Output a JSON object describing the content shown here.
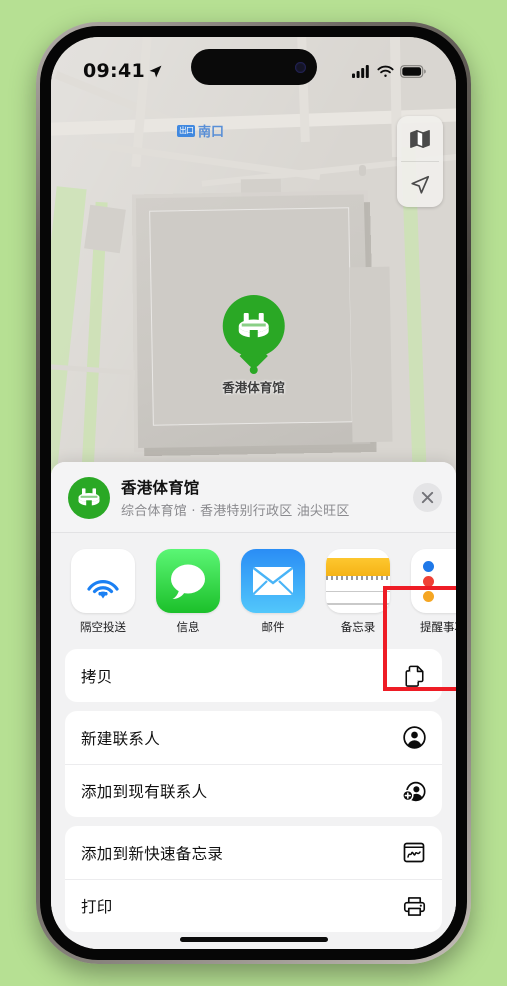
{
  "status_bar": {
    "time": "09:41",
    "location_icon": "location-arrow-icon",
    "signal_icon": "cellular-signal-icon",
    "wifi_icon": "wifi-icon",
    "battery_icon": "battery-icon"
  },
  "map": {
    "exit_badge": "出口",
    "exit_label": "南口",
    "pin_label": "香港体育馆",
    "controls": [
      {
        "name": "map-layers-button",
        "icon": "map-layers-icon"
      },
      {
        "name": "current-location-button",
        "icon": "navigation-arrow-icon"
      }
    ]
  },
  "share_sheet": {
    "poi_icon": "stadium-pin-icon",
    "title": "香港体育馆",
    "subtitle": "综合体育馆 · 香港特别行政区 油尖旺区",
    "close_label": "×",
    "apps": [
      {
        "label": "隔空投送",
        "icon": "airdrop-icon",
        "highlighted": false
      },
      {
        "label": "信息",
        "icon": "messages-icon",
        "highlighted": false
      },
      {
        "label": "邮件",
        "icon": "mail-icon",
        "highlighted": false
      },
      {
        "label": "备忘录",
        "icon": "notes-icon",
        "highlighted": true
      },
      {
        "label": "提醒事项",
        "icon": "reminders-icon",
        "highlighted": false
      }
    ],
    "actions": [
      {
        "label": "拷贝",
        "icon": "copy-icon"
      },
      {
        "label": "新建联系人",
        "icon": "person-circle-icon"
      },
      {
        "label": "添加到现有联系人",
        "icon": "person-add-icon"
      },
      {
        "label": "添加到新快速备忘录",
        "icon": "quick-note-icon"
      },
      {
        "label": "打印",
        "icon": "printer-icon"
      }
    ]
  },
  "annotation": {
    "highlight_color": "#ee1c25",
    "highlight_target": "备忘录"
  },
  "colors": {
    "background": "#b6e093",
    "accent_green": "#2aa825",
    "sheet_background": "#f2f2f3",
    "notes_yellow": "#f5b316"
  }
}
